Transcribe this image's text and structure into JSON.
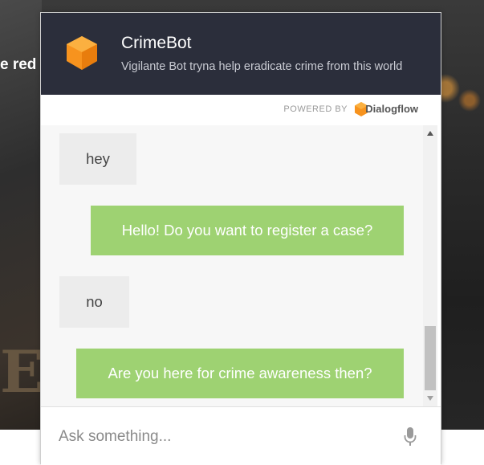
{
  "background": {
    "partial_text": "e red",
    "partial_letters": "E"
  },
  "header": {
    "title": "CrimeBot",
    "subtitle": "Vigilante Bot tryna help eradicate crime from this world",
    "logo_icon": "orange-cube-icon",
    "background_color": "#2b2e3b"
  },
  "powered_by": {
    "label": "POWERED BY",
    "brand": "Dialogflow",
    "brand_icon": "dialogflow-icon"
  },
  "messages": [
    {
      "sender": "user",
      "text": "hey"
    },
    {
      "sender": "bot",
      "text": "Hello! Do you want to register a case?"
    },
    {
      "sender": "user",
      "text": "no"
    },
    {
      "sender": "bot",
      "text": "Are you here for crime awareness then?"
    }
  ],
  "input": {
    "placeholder": "Ask something...",
    "value": "",
    "mic_icon": "microphone-icon"
  },
  "colors": {
    "bot_bubble": "#9ed272",
    "user_bubble": "#ececec",
    "accent": "#f7931e"
  }
}
